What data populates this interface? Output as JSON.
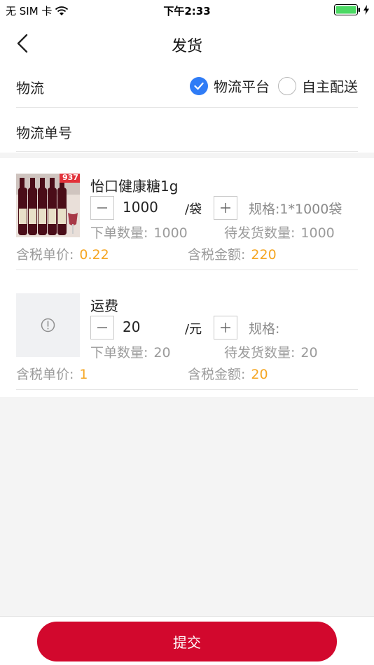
{
  "status_bar": {
    "carrier": "无 SIM 卡",
    "time": "下午2:33"
  },
  "nav": {
    "title": "发货"
  },
  "logistics": {
    "label": "物流",
    "options": [
      {
        "label": "物流平台",
        "checked": true
      },
      {
        "label": "自主配送",
        "checked": false
      }
    ],
    "tracking_label": "物流单号",
    "tracking_placeholder": ""
  },
  "items": [
    {
      "name": "怡口健康糖1g",
      "quantity": "1000",
      "unit": "/袋",
      "spec": "规格:1*1000袋",
      "order_qty_label": "下单数量:",
      "order_qty": "1000",
      "pending_qty_label": "待发货数量:",
      "pending_qty": "1000",
      "unit_price_label": "含税单价:",
      "unit_price": "0.22",
      "amount_label": "含税金额:",
      "amount": "220",
      "image_badge": "937"
    },
    {
      "name": "运费",
      "quantity": "20",
      "unit": "/元",
      "spec": "规格:",
      "order_qty_label": "下单数量:",
      "order_qty": "20",
      "pending_qty_label": "待发货数量:",
      "pending_qty": "20",
      "unit_price_label": "含税单价:",
      "unit_price": "1",
      "amount_label": "含税金额:",
      "amount": "20"
    }
  ],
  "submit_label": "提交",
  "colors": {
    "accent_blue": "#2f7cf6",
    "submit_red": "#d2082d",
    "price_orange": "#f5a623"
  }
}
